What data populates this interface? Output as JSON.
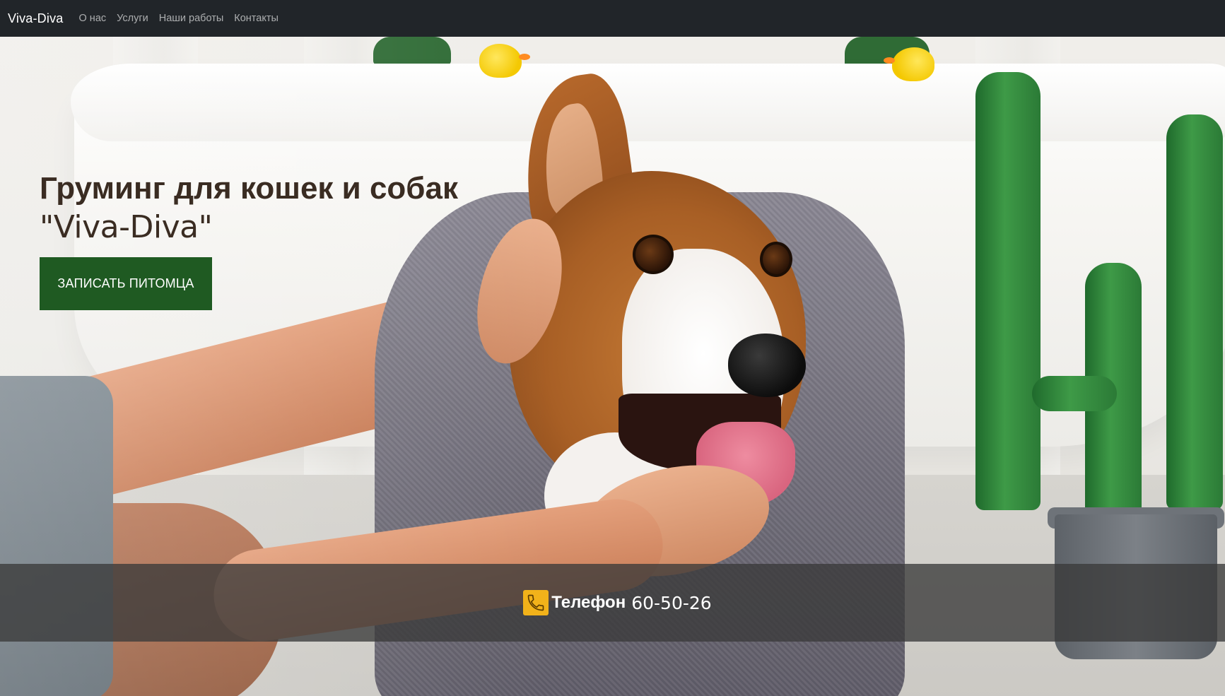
{
  "navbar": {
    "brand": "Viva-Diva",
    "items": [
      {
        "label": "О нас"
      },
      {
        "label": "Услуги"
      },
      {
        "label": "Наши работы"
      },
      {
        "label": "Контакты"
      }
    ]
  },
  "hero": {
    "title": "Груминг для кошек и собак",
    "subtitle": "\"Viva-Diva\"",
    "cta_label": "ЗАПИСАТЬ ПИТОМЦА",
    "image_icon": "corgi-towel-photo"
  },
  "contact": {
    "icon": "phone-icon",
    "label": "Телефон",
    "number": "60-50-26"
  },
  "colors": {
    "navbar_bg": "#212529",
    "cta_bg": "#1f5a22",
    "title_color": "#3a2c22",
    "phone_icon_bg": "#f2b21a",
    "phone_bar_bg": "#3a3a3a"
  }
}
